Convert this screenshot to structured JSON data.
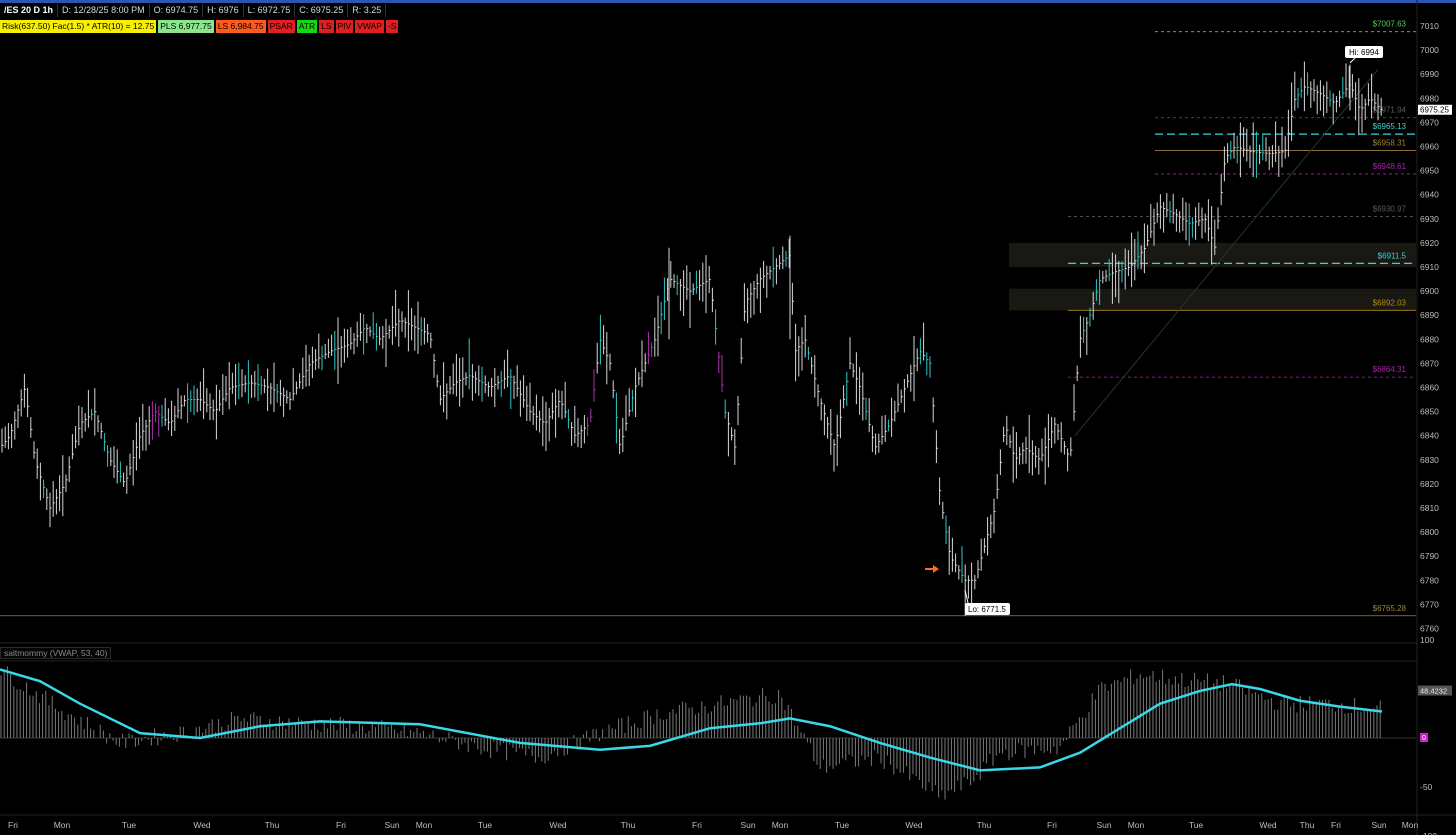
{
  "header": {
    "symbol": "/ES 20 D 1h",
    "date": "D: 12/28/25 8:00 PM",
    "open": "O: 6974.75",
    "high": "H: 6976",
    "low": "L: 6972.75",
    "close": "C: 6975.25",
    "range": "R: 3.25"
  },
  "studies": [
    {
      "label": "Risk(637.50) Fac(1.5) * ATR(10) = 12.75",
      "bg": "#f6f000"
    },
    {
      "label": "PLS 6,977.75",
      "bg": "#8be68b"
    },
    {
      "label": "LS 6,984.75",
      "bg": "#ff5a1e"
    },
    {
      "label": "PSAR",
      "bg": "#e02020"
    },
    {
      "label": "ATR",
      "bg": "#13d913"
    },
    {
      "label": "LS",
      "bg": "#e02020"
    },
    {
      "label": "PIV",
      "bg": "#e02020"
    },
    {
      "label": "VWAP",
      "bg": "#e02020"
    },
    {
      "label": "-S",
      "bg": "#e02020"
    }
  ],
  "price_axis": {
    "ticks": [
      "7010",
      "7000",
      "6990",
      "6980",
      "6970",
      "6960",
      "6950",
      "6940",
      "6930",
      "6920",
      "6910",
      "6900",
      "6890",
      "6880",
      "6870",
      "6860",
      "6850",
      "6840",
      "6830",
      "6820",
      "6810",
      "6800",
      "6790",
      "6780",
      "6770",
      "6760"
    ],
    "current_price": "6975.25"
  },
  "levels": [
    {
      "label": "$7007.63",
      "color": "#4fd24f"
    },
    {
      "label": "$6971.94",
      "color": "#5a5a5a"
    },
    {
      "label": "$6965.13",
      "color": "#39d4d4"
    },
    {
      "label": "$6958.31",
      "color": "#a08040"
    },
    {
      "label": "$6948.61",
      "color": "#b020b0"
    },
    {
      "label": "$6930.97",
      "color": "#5a5a5a"
    },
    {
      "label": "$6911.5",
      "color": "#39d4d4"
    },
    {
      "label": "$6892.03",
      "color": "#b08a20"
    },
    {
      "label": "$6864.31",
      "color": "#b020b0"
    },
    {
      "label": "$6765.28",
      "color": "#a08040"
    }
  ],
  "hi_label": "Hi: 6994",
  "lo_label": "Lo: 6771.5",
  "oscillator": {
    "title": "saltmommy (VWAP, 53, 40)",
    "ticks": [
      "100",
      "50",
      "0",
      "-50",
      "-100"
    ],
    "current_value": "48.4232",
    "zero_badge": "0"
  },
  "time_axis": [
    "Fri",
    "Mon",
    "Tue",
    "Wed",
    "Thu",
    "Fri",
    "Sun",
    "Mon",
    "Tue",
    "Wed",
    "Thu",
    "Fri",
    "Sun",
    "Mon",
    "Tue",
    "Wed",
    "Thu",
    "Fri",
    "Sun",
    "Mon",
    "Tue",
    "Wed",
    "Thu",
    "Fri",
    "Sun",
    "Mon"
  ]
}
